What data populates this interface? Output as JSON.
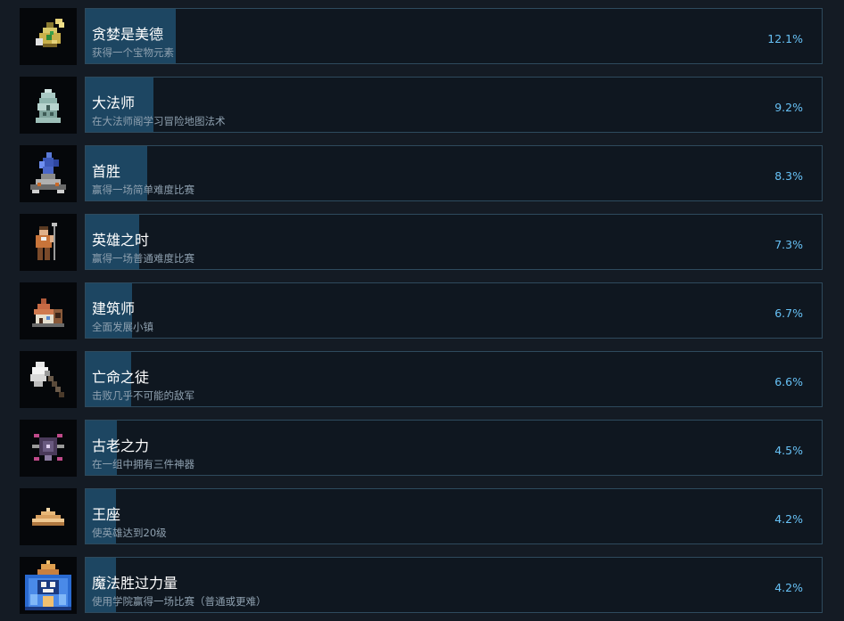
{
  "achievements": [
    {
      "icon": "treasure-pouch-icon",
      "title": "贪婪是美德",
      "desc": "获得一个宝物元素",
      "percent": "12.1%",
      "ratio": 0.121
    },
    {
      "icon": "mage-tower-icon",
      "title": "大法师",
      "desc": "在大法师阁学习冒险地图法术",
      "percent": "9.2%",
      "ratio": 0.092
    },
    {
      "icon": "crystal-altar-icon",
      "title": "首胜",
      "desc": "赢得一场简单难度比赛",
      "percent": "8.3%",
      "ratio": 0.083
    },
    {
      "icon": "hero-with-staff-icon",
      "title": "英雄之时",
      "desc": "赢得一场普通难度比赛",
      "percent": "7.3%",
      "ratio": 0.073
    },
    {
      "icon": "town-house-icon",
      "title": "建筑师",
      "desc": "全面发展小镇",
      "percent": "6.7%",
      "ratio": 0.067
    },
    {
      "icon": "battle-axe-icon",
      "title": "亡命之徒",
      "desc": "击败几乎不可能的敌军",
      "percent": "6.6%",
      "ratio": 0.066
    },
    {
      "icon": "ancient-artifact-icon",
      "title": "古老之力",
      "desc": "在一组中拥有三件神器",
      "percent": "4.5%",
      "ratio": 0.045
    },
    {
      "icon": "crown-throne-icon",
      "title": "王座",
      "desc": "使英雄达到20级",
      "percent": "4.2%",
      "ratio": 0.042
    },
    {
      "icon": "academy-dome-icon",
      "title": "魔法胜过力量",
      "desc": "使用学院赢得一场比赛（普通或更难）",
      "percent": "4.2%",
      "ratio": 0.042
    }
  ]
}
